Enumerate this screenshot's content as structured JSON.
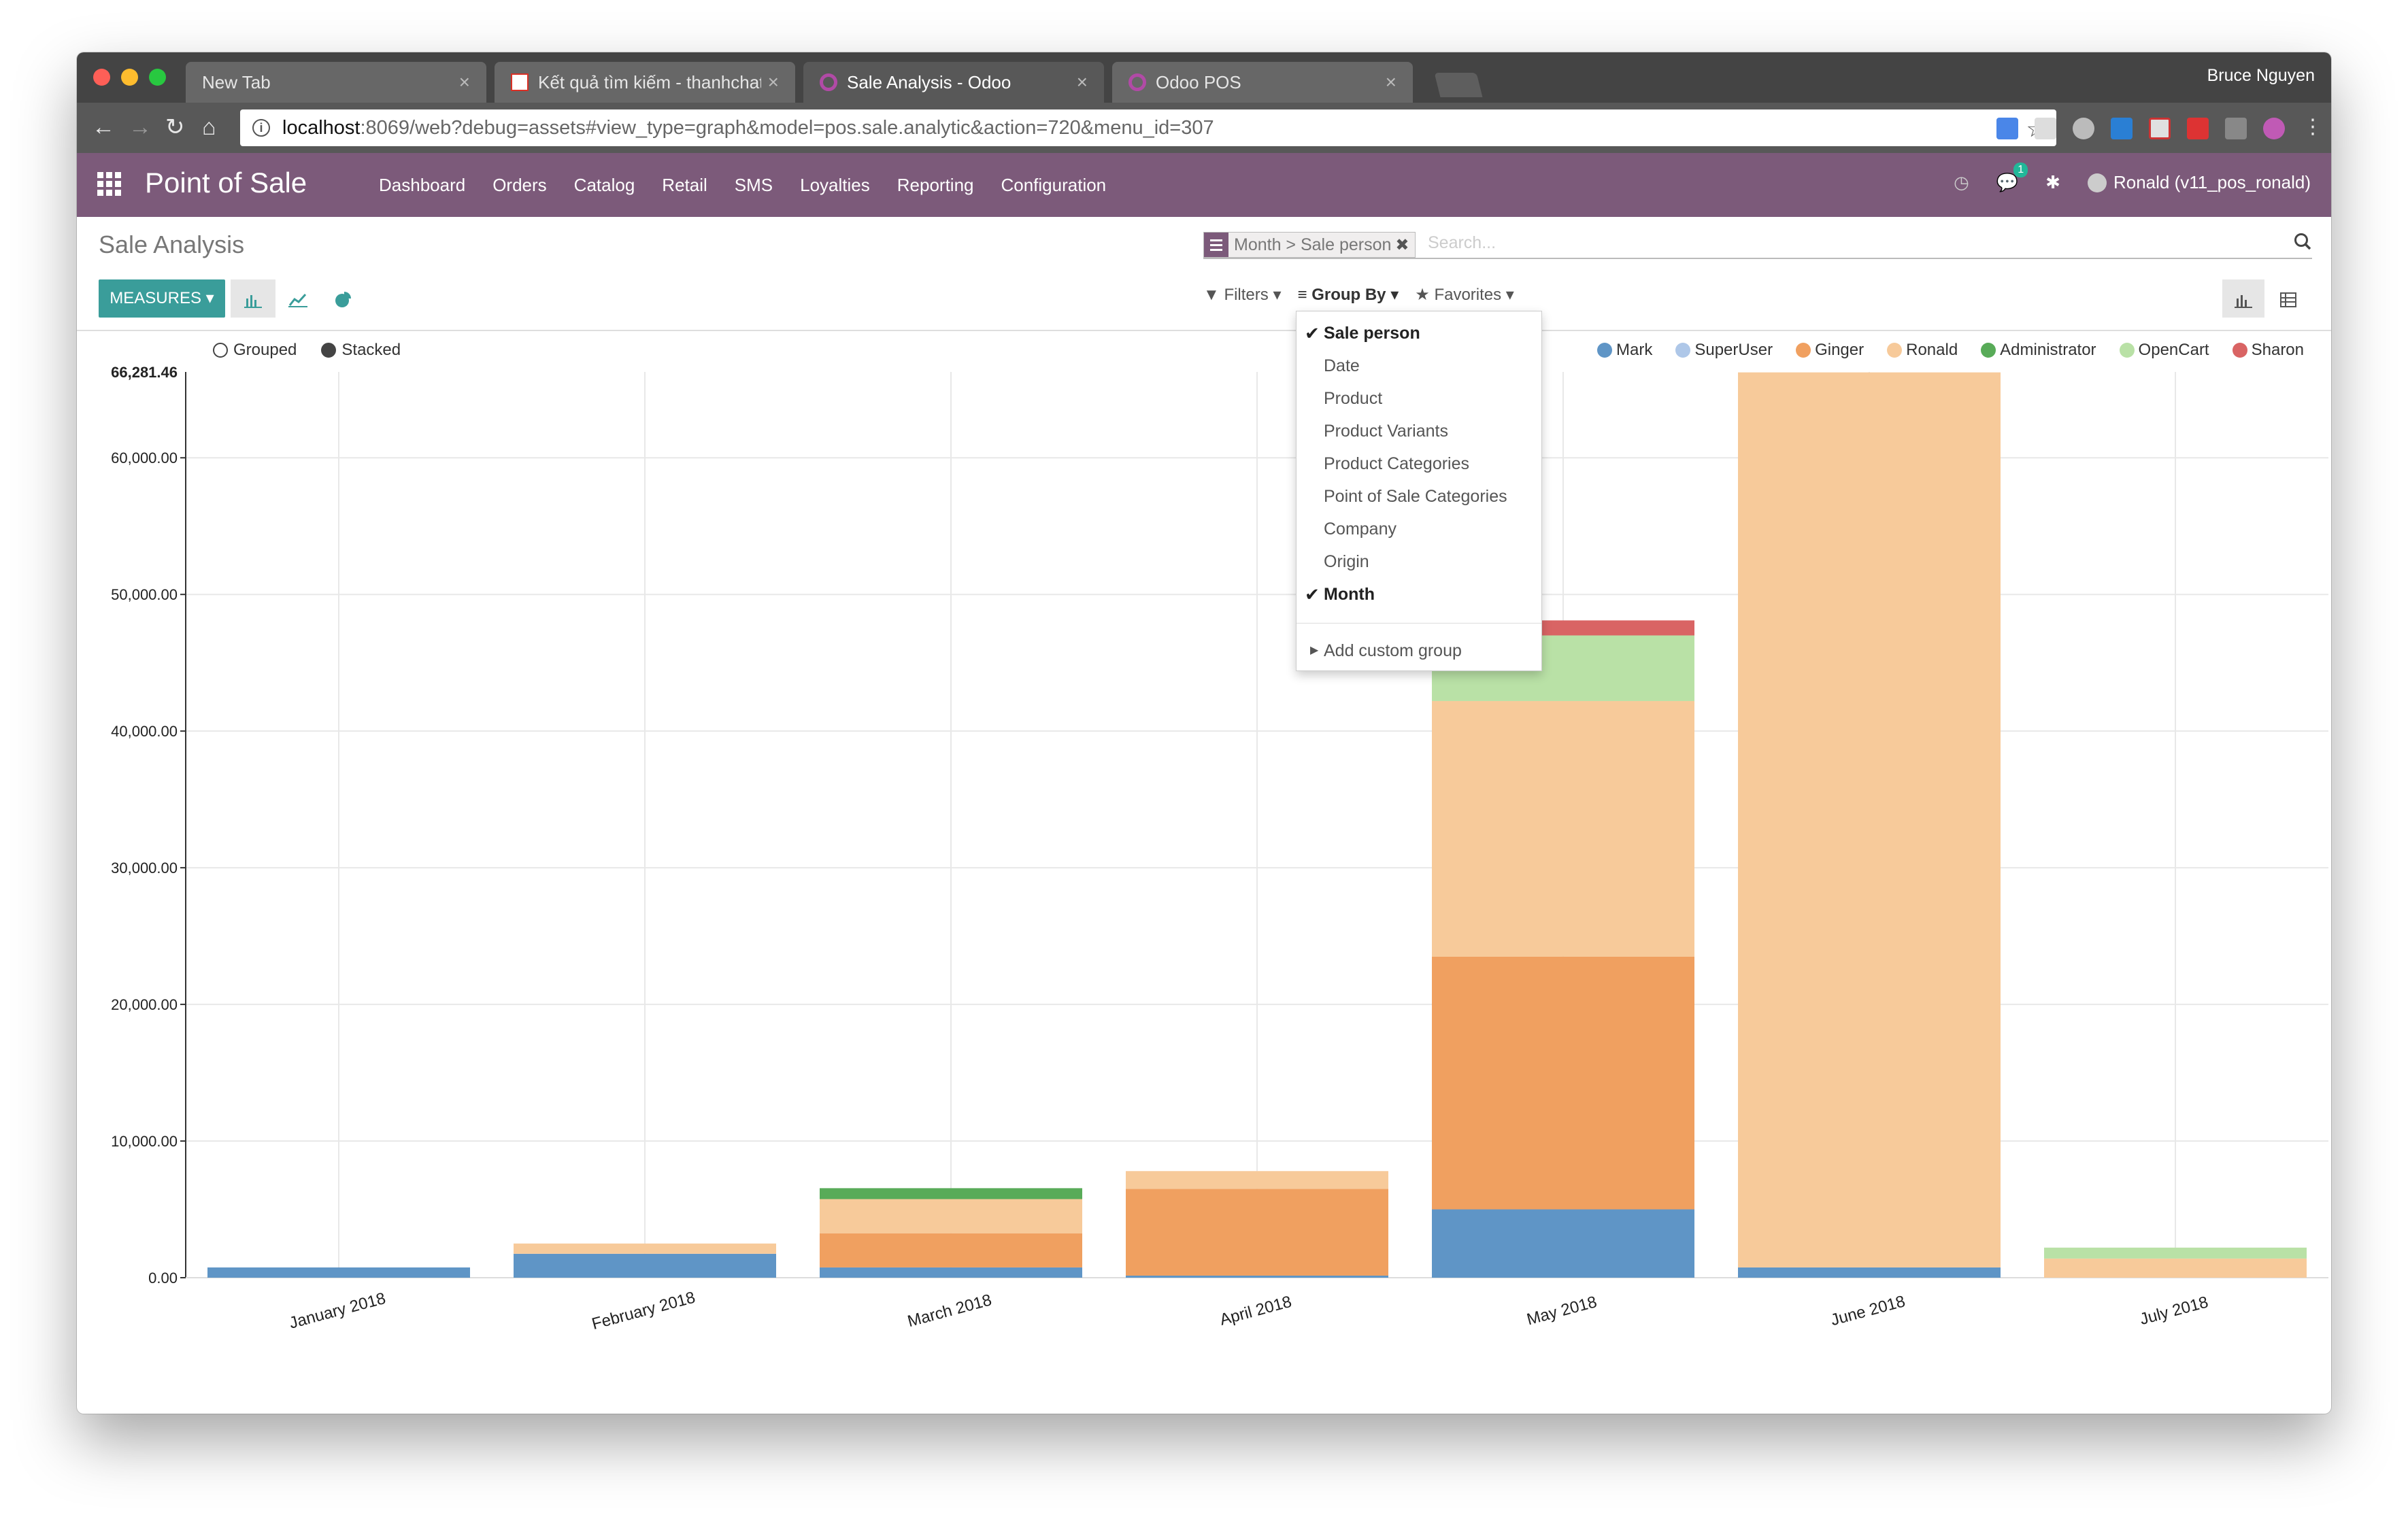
{
  "browser": {
    "tabs": [
      {
        "title": "New Tab",
        "active": false
      },
      {
        "title": "Kết quả tìm kiếm - thanhchatv",
        "active": false
      },
      {
        "title": "Sale Analysis - Odoo",
        "active": true
      },
      {
        "title": "Odoo POS",
        "active": false
      }
    ],
    "profile_name": "Bruce Nguyen",
    "url_host": "localhost",
    "url_rest": ":8069/web?debug=assets#view_type=graph&model=pos.sale.analytic&action=720&menu_id=307",
    "traffic_colors": [
      "#fe5f57",
      "#febc2e",
      "#28c840"
    ]
  },
  "app": {
    "brand": "Point of Sale",
    "menu": [
      "Dashboard",
      "Orders",
      "Catalog",
      "Retail",
      "SMS",
      "Loyalties",
      "Reporting",
      "Configuration"
    ],
    "user": "Ronald (v11_pos_ronald)",
    "chat_badge": "1",
    "navbar_color": "#7c5a7a"
  },
  "control": {
    "title": "Sale Analysis",
    "facet": "Month > Sale person",
    "search_placeholder": "Search...",
    "measures_label": "MEASURES",
    "filters_label": "Filters",
    "groupby_label": "Group By",
    "favorites_label": "Favorites"
  },
  "groupby_menu": {
    "items": [
      {
        "label": "Sale person",
        "checked": true
      },
      {
        "label": "Date",
        "checked": false
      },
      {
        "label": "Product",
        "checked": false
      },
      {
        "label": "Product Variants",
        "checked": false
      },
      {
        "label": "Product Categories",
        "checked": false
      },
      {
        "label": "Point of Sale Categories",
        "checked": false
      },
      {
        "label": "Company",
        "checked": false
      },
      {
        "label": "Origin",
        "checked": false
      },
      {
        "label": "Month",
        "checked": true
      }
    ],
    "custom": "Add custom group"
  },
  "chart_modes": {
    "grouped": "Grouped",
    "stacked": "Stacked"
  },
  "chart_data": {
    "type": "bar",
    "stacked": true,
    "categories": [
      "January 2018",
      "February 2018",
      "March 2018",
      "April 2018",
      "May 2018",
      "June 2018",
      "July 2018"
    ],
    "series": [
      {
        "name": "Mark",
        "color": "#5f95c6",
        "values": [
          750,
          1750,
          750,
          150,
          5000,
          750,
          0
        ]
      },
      {
        "name": "SuperUser",
        "color": "#aec7e8",
        "values": [
          0,
          0,
          0,
          0,
          0,
          0,
          0
        ]
      },
      {
        "name": "Ginger",
        "color": "#f0a060",
        "values": [
          0,
          0,
          2500,
          6350,
          18500,
          0,
          0
        ]
      },
      {
        "name": "Ronald",
        "color": "#f7ca9a",
        "values": [
          0,
          750,
          2500,
          1300,
          18700,
          65500,
          1400
        ]
      },
      {
        "name": "Administrator",
        "color": "#58ab58",
        "values": [
          0,
          0,
          800,
          0,
          0,
          0,
          0
        ]
      },
      {
        "name": "OpenCart",
        "color": "#b9e1a6",
        "values": [
          0,
          0,
          0,
          0,
          4800,
          0,
          800
        ]
      },
      {
        "name": "Sharon",
        "color": "#d96464",
        "values": [
          0,
          0,
          0,
          0,
          1100,
          0,
          0
        ]
      }
    ],
    "ylim": [
      0,
      66281.46
    ],
    "yticks": [
      "0.00",
      "10,000.00",
      "20,000.00",
      "30,000.00",
      "40,000.00",
      "50,000.00",
      "60,000.00"
    ],
    "ymax_label": "66,281.46",
    "ytick_values": [
      0,
      10000,
      20000,
      30000,
      40000,
      50000,
      60000
    ],
    "grid": true,
    "legend_position": "top-right"
  }
}
